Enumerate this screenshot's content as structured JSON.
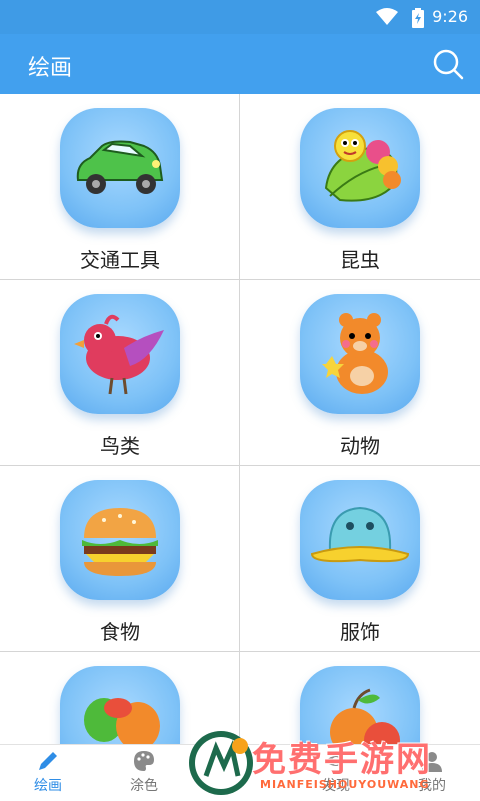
{
  "status": {
    "time": "9:26"
  },
  "appbar": {
    "title": "绘画",
    "search_icon": "search-icon"
  },
  "categories": [
    {
      "label": "交通工具",
      "icon": "car-icon"
    },
    {
      "label": "昆虫",
      "icon": "caterpillar-icon"
    },
    {
      "label": "鸟类",
      "icon": "bird-icon"
    },
    {
      "label": "动物",
      "icon": "bear-icon"
    },
    {
      "label": "食物",
      "icon": "burger-icon"
    },
    {
      "label": "服饰",
      "icon": "hat-icon"
    },
    {
      "label": "",
      "icon": "vegetable-icon"
    },
    {
      "label": "",
      "icon": "fruit-icon"
    }
  ],
  "bottom_nav": [
    {
      "label": "绘画",
      "icon": "pencil-icon",
      "active": true
    },
    {
      "label": "涂色",
      "icon": "palette-icon",
      "active": false
    },
    {
      "label": "",
      "icon": "center-icon",
      "active": false
    },
    {
      "label": "发现",
      "icon": "eye-icon",
      "active": false
    },
    {
      "label": "我的",
      "icon": "user-icon",
      "active": false
    }
  ],
  "watermark": {
    "text": "免费手游网",
    "sub": "MIANFEISHOUYOUWANG"
  },
  "colors": {
    "primary": "#42a0ee",
    "statusbar": "#3f9be6",
    "nav_active": "#2f8de6"
  }
}
